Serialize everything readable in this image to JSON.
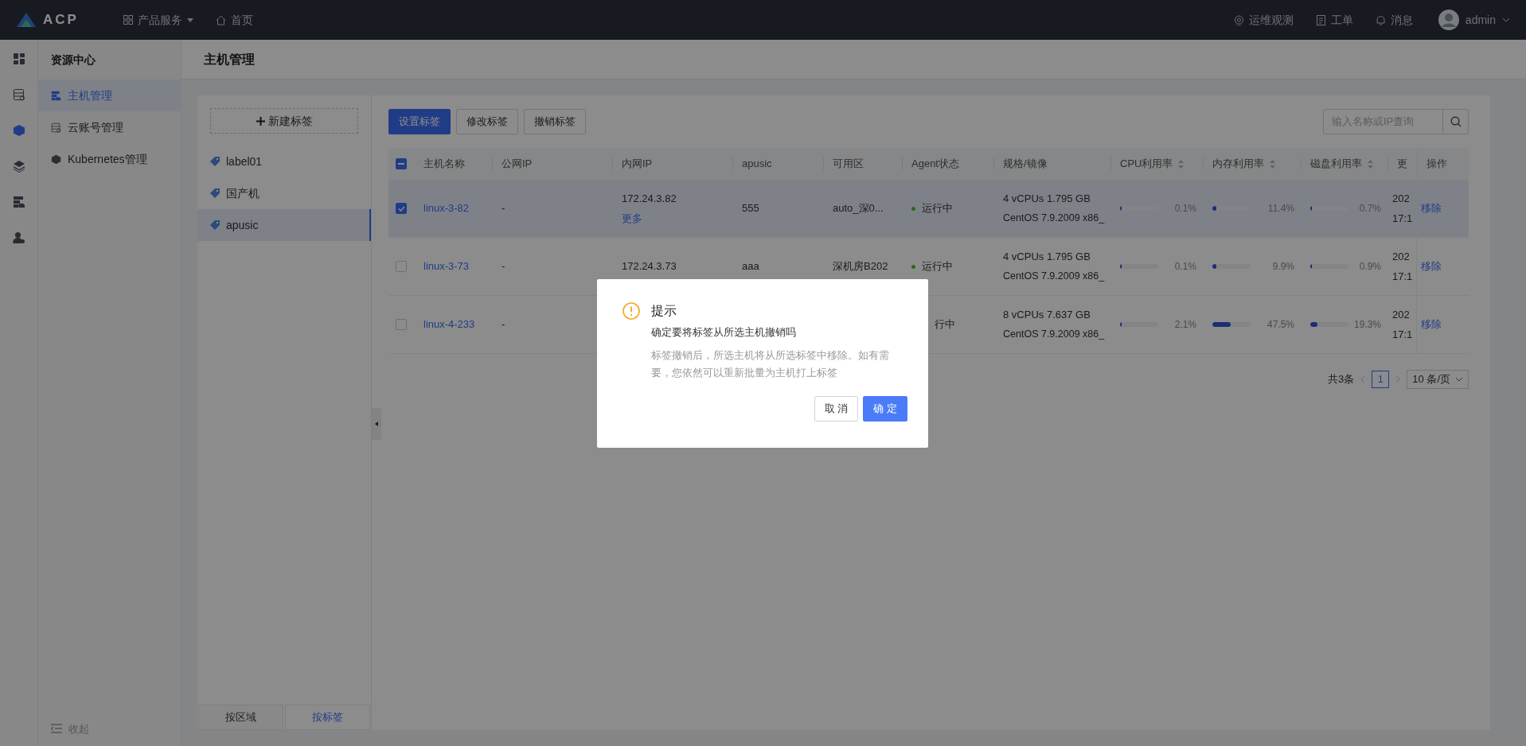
{
  "topbar": {
    "logo": "ACP",
    "nav": [
      {
        "kind": "dropdown",
        "label": "产品服务"
      },
      {
        "kind": "home",
        "label": "首页"
      }
    ],
    "actions": [
      {
        "kind": "monitor",
        "label": "运维观测"
      },
      {
        "kind": "ticket",
        "label": "工单"
      },
      {
        "kind": "bell",
        "label": "消息"
      }
    ],
    "user": "admin"
  },
  "rail": [
    {
      "selected": false
    },
    {
      "selected": false
    },
    {
      "selected": true
    },
    {
      "selected": false
    },
    {
      "selected": false
    },
    {
      "selected": false
    }
  ],
  "sidebar": {
    "title": "资源中心",
    "items": [
      {
        "label": "主机管理",
        "selected": true
      },
      {
        "label": "云账号管理",
        "selected": false
      },
      {
        "label": "Kubernetes管理",
        "selected": false
      }
    ],
    "collapse": "收起"
  },
  "page_title": "主机管理",
  "label_panel": {
    "new_button": "新建标签",
    "tags": [
      {
        "label": "label01",
        "selected": false
      },
      {
        "label": "国产机",
        "selected": false
      },
      {
        "label": "apusic",
        "selected": true
      }
    ],
    "tabs": [
      {
        "label": "按区域",
        "selected": false
      },
      {
        "label": "按标签",
        "selected": true
      }
    ]
  },
  "toolbar": {
    "buttons": [
      {
        "kind": "primary",
        "label": "设置标签"
      },
      {
        "kind": "default",
        "label": "修改标签"
      },
      {
        "kind": "default",
        "label": "撤销标签"
      }
    ],
    "search": {
      "placeholder": "输入名称或IP查询"
    }
  },
  "table": {
    "partially_selected": true,
    "columns": [
      {
        "label": "主机名称",
        "sortable": false
      },
      {
        "label": "公网IP",
        "sortable": false
      },
      {
        "label": "内网IP",
        "sortable": false
      },
      {
        "label": "apusic",
        "sortable": false
      },
      {
        "label": "可用区",
        "sortable": false
      },
      {
        "label": "Agent状态",
        "sortable": false
      },
      {
        "label": "规格/镜像",
        "sortable": false
      },
      {
        "label": "CPU利用率",
        "sortable": true
      },
      {
        "label": "内存利用率",
        "sortable": true
      },
      {
        "label": "磁盘利用率",
        "sortable": true
      },
      {
        "label": "更",
        "sortable": false
      },
      {
        "label": "操作",
        "sortable": false
      }
    ],
    "rows": [
      {
        "selected": true,
        "name": "linux-3-82",
        "public_ip": "-",
        "private_ip": "172.24.3.82",
        "more": "更多",
        "apusic": "555",
        "zone": "auto_深0...",
        "status": "运行中",
        "status_dot": true,
        "spec": "4 vCPUs 1.795 GB",
        "image": "CentOS 7.9.2009 x86_",
        "cpu": {
          "level": 0.001,
          "reading": "0.1%"
        },
        "memory": {
          "level": 0.114,
          "reading": "11.4%"
        },
        "disk": {
          "level": 0.007,
          "reading": "0.7%"
        },
        "updated": [
          "202",
          "17:1"
        ],
        "action": "移除"
      },
      {
        "selected": false,
        "name": "linux-3-73",
        "public_ip": "-",
        "private_ip": "172.24.3.73",
        "apusic": "aaa",
        "zone": "深机房B202",
        "status": "运行中",
        "status_dot": true,
        "spec": "4 vCPUs 1.795 GB",
        "image": "CentOS 7.9.2009 x86_",
        "cpu": {
          "level": 0.001,
          "reading": "0.1%"
        },
        "memory": {
          "level": 0.099,
          "reading": "9.9%"
        },
        "disk": {
          "level": 0.009,
          "reading": "0.9%"
        },
        "updated": [
          "202",
          "17:1"
        ],
        "action": "移除"
      },
      {
        "selected": false,
        "name": "linux-4-233",
        "public_ip": "-",
        "status": "行中",
        "spec": "8 vCPUs 7.637 GB",
        "image": "CentOS 7.9.2009 x86_",
        "cpu": {
          "level": 0.021,
          "reading": "2.1%"
        },
        "memory": {
          "level": 0.475,
          "reading": "47.5%"
        },
        "disk": {
          "level": 0.193,
          "reading": "19.3%"
        },
        "updated": [
          "202",
          "17:1"
        ],
        "action": "移除"
      }
    ]
  },
  "pagination": {
    "total": "共3条",
    "pages": [
      {
        "label": "1",
        "selected": true
      }
    ],
    "page_size": "10 条/页"
  },
  "modal": {
    "title": "提示",
    "message": "确定要将标签从所选主机撤销吗",
    "detail": "标签撤销后，所选主机将从所选标签中移除。如有需要，您依然可以重新批量为主机打上标签",
    "buttons": [
      {
        "kind": "default",
        "label": "取 消"
      },
      {
        "kind": "primary",
        "label": "确 定"
      }
    ]
  }
}
